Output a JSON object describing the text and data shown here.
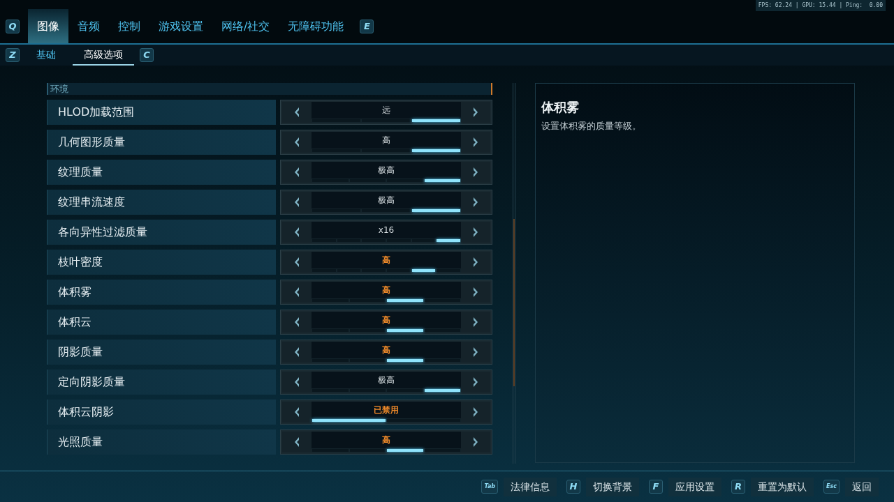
{
  "stats": "FPS: 62.24 | GPU: 15.44 | Ping:  0.00",
  "tabs_prev_key": "Q",
  "tabs": [
    {
      "label": "图像",
      "selected": true
    },
    {
      "label": "音频",
      "selected": false
    },
    {
      "label": "控制",
      "selected": false
    },
    {
      "label": "游戏设置",
      "selected": false
    },
    {
      "label": "网络/社交",
      "selected": false
    },
    {
      "label": "无障碍功能",
      "selected": false
    }
  ],
  "tabs_next_key": "E",
  "subtabs_prev_key": "Z",
  "subtabs": [
    {
      "label": "基础",
      "selected": false
    },
    {
      "label": "高级选项",
      "selected": true
    }
  ],
  "subtabs_next_key": "C",
  "section": "环境",
  "settings": [
    {
      "label": "HLOD加载范围",
      "value": "远",
      "modified": false,
      "segments": [
        {
          "selected": false
        },
        {
          "selected": false
        },
        {
          "selected": true
        }
      ]
    },
    {
      "label": "几何图形质量",
      "value": "高",
      "modified": false,
      "segments": [
        {
          "selected": false
        },
        {
          "selected": false
        },
        {
          "selected": true
        }
      ]
    },
    {
      "label": "纹理质量",
      "value": "极高",
      "modified": false,
      "segments": [
        {
          "selected": false
        },
        {
          "selected": false
        },
        {
          "selected": false
        },
        {
          "selected": true
        }
      ]
    },
    {
      "label": "纹理串流速度",
      "value": "极高",
      "modified": false,
      "segments": [
        {
          "selected": false
        },
        {
          "selected": false
        },
        {
          "selected": true
        }
      ]
    },
    {
      "label": "各向异性过滤质量",
      "value": "x16",
      "modified": false,
      "segments": [
        {
          "selected": false
        },
        {
          "selected": false
        },
        {
          "selected": false
        },
        {
          "selected": false
        },
        {
          "selected": false
        },
        {
          "selected": true
        }
      ]
    },
    {
      "label": "枝叶密度",
      "value": "高",
      "modified": true,
      "segments": [
        {
          "selected": false
        },
        {
          "selected": false
        },
        {
          "selected": false
        },
        {
          "selected": false
        },
        {
          "selected": true
        },
        {
          "selected": false
        }
      ]
    },
    {
      "label": "体积雾",
      "value": "高",
      "modified": true,
      "segments": [
        {
          "selected": false
        },
        {
          "selected": false
        },
        {
          "selected": true
        },
        {
          "selected": false
        }
      ]
    },
    {
      "label": "体积云",
      "value": "高",
      "modified": true,
      "segments": [
        {
          "selected": false
        },
        {
          "selected": false
        },
        {
          "selected": true
        },
        {
          "selected": false
        }
      ]
    },
    {
      "label": "阴影质量",
      "value": "高",
      "modified": true,
      "segments": [
        {
          "selected": false
        },
        {
          "selected": false
        },
        {
          "selected": true
        },
        {
          "selected": false
        }
      ]
    },
    {
      "label": "定向阴影质量",
      "value": "极高",
      "modified": false,
      "segments": [
        {
          "selected": false
        },
        {
          "selected": false
        },
        {
          "selected": false
        },
        {
          "selected": true
        }
      ]
    },
    {
      "label": "体积云阴影",
      "value": "已禁用",
      "modified": true,
      "segments": [
        {
          "selected": true
        },
        {
          "selected": false
        }
      ]
    },
    {
      "label": "光照质量",
      "value": "高",
      "modified": true,
      "segments": [
        {
          "selected": false
        },
        {
          "selected": false
        },
        {
          "selected": true
        },
        {
          "selected": false
        }
      ]
    }
  ],
  "detail": {
    "title": "体积雾",
    "description": "设置体积雾的质量等级。"
  },
  "footer_actions": [
    {
      "key": "Tab",
      "label": "法律信息"
    },
    {
      "key": "H",
      "label": "切换背景"
    },
    {
      "key": "F",
      "label": "应用设置"
    },
    {
      "key": "R",
      "label": "重置为默认"
    },
    {
      "key": "Esc",
      "label": "返回"
    }
  ]
}
